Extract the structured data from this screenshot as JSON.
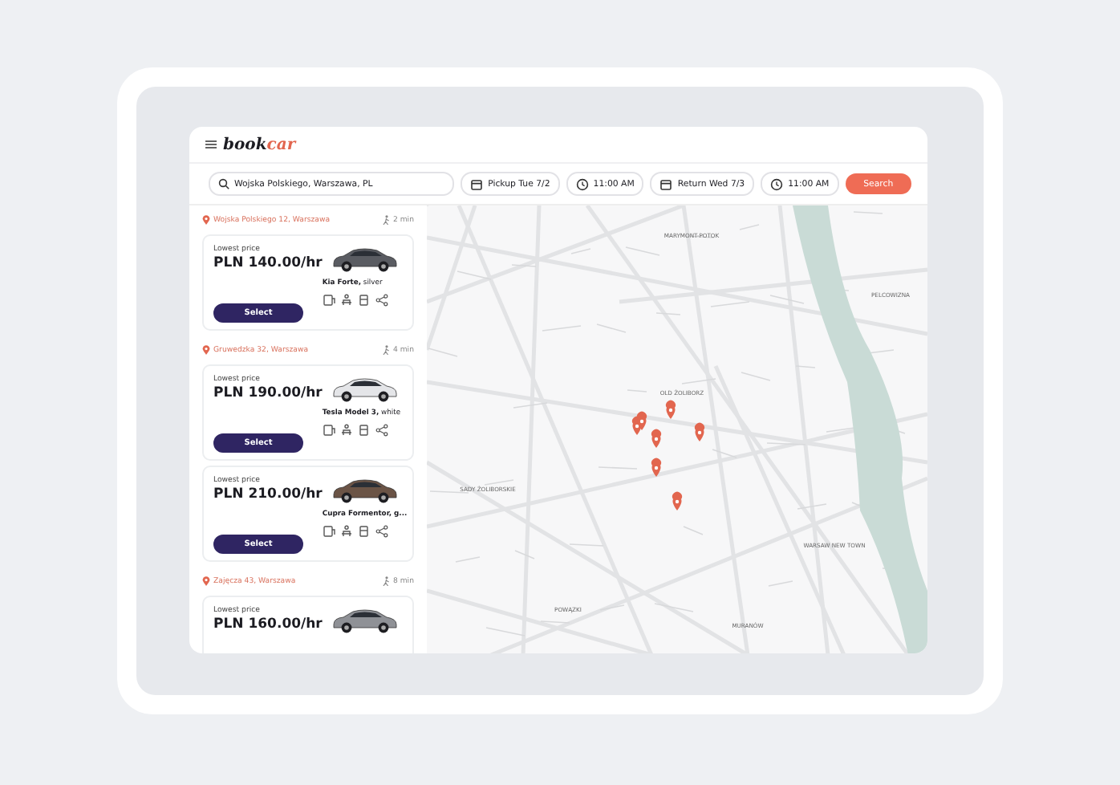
{
  "header": {
    "logo_dark": "book",
    "logo_accent": "car"
  },
  "search_bar": {
    "location": "Wojska Polskiego, Warszawa, PL",
    "pickup_date": "Pickup Tue 7/2",
    "pickup_time": "11:00 AM",
    "return_date": "Return Wed 7/3",
    "return_time": "11:00 AM",
    "button": "Search"
  },
  "locations": [
    {
      "address": "Wojska Polskiego 12, Warszawa",
      "walk": "2 min",
      "cars": [
        {
          "label": "Lowest price",
          "price": "PLN 140.00/hr",
          "name": "**Kia Forte,** silver",
          "color": "#5a5c62",
          "button": "Select"
        }
      ]
    },
    {
      "address": "Gruwedzka 32, Warszawa",
      "walk": "4 min",
      "cars": [
        {
          "label": "Lowest price",
          "price": "PLN 190.00/hr",
          "name": "**Tesla Model 3,** white",
          "color": "#e4e5e8",
          "button": "Select"
        },
        {
          "label": "Lowest price",
          "price": "PLN 210.00/hr",
          "name": "**Cupra Formentor, g...**",
          "color": "#6b5446",
          "button": "Select"
        }
      ]
    },
    {
      "address": "Zajęcza 43, Warszawa",
      "walk": "8 min",
      "cars": [
        {
          "label": "Lowest price",
          "price": "PLN 160.00/hr",
          "color": "#8f9196"
        }
      ]
    }
  ],
  "map": {
    "labels": [
      "MARYMONT-POTOK",
      "PELCOWIZNA",
      "OLD ŻOLIBORZ",
      "SADY ŻOLIBORSKIE",
      "WARSAW NEW TOWN",
      "POWĄZKI",
      "MURANÓW"
    ]
  }
}
